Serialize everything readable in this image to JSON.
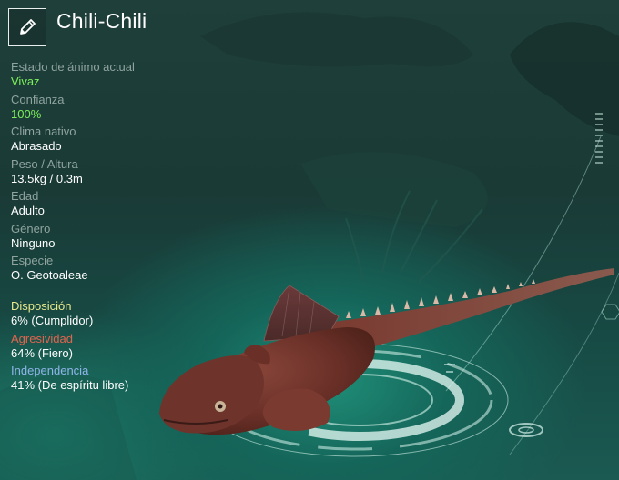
{
  "creature": {
    "name": "Chili-Chili",
    "edit_icon": "pencil-icon"
  },
  "stats": [
    {
      "label": "Estado de ánimo actual",
      "value": "Vivaz",
      "highlight": true
    },
    {
      "label": "Confianza",
      "value": "100%",
      "highlight": true
    },
    {
      "label": "Clima nativo",
      "value": "Abrasado",
      "highlight": false
    },
    {
      "label": "Peso / Altura",
      "value": "13.5kg / 0.3m",
      "highlight": false
    },
    {
      "label": "Edad",
      "value": "Adulto",
      "highlight": false
    },
    {
      "label": "Género",
      "value": "Ninguno",
      "highlight": false
    },
    {
      "label": "Especie",
      "value": "O. Geotoaleae",
      "highlight": false
    }
  ],
  "traits": [
    {
      "label": "Disposición",
      "value": "6% (Cumplidor)",
      "color": "#e8ea8c"
    },
    {
      "label": "Agresividad",
      "value": "64% (Fiero)",
      "color": "#e0644e"
    },
    {
      "label": "Independencia",
      "value": "41% (De espíritu libre)",
      "color": "#8fb4e8"
    }
  ],
  "colors": {
    "highlight_value": "#7cf05a",
    "hologram": "#d8f5ec",
    "creature_body": "#7a3a30"
  }
}
